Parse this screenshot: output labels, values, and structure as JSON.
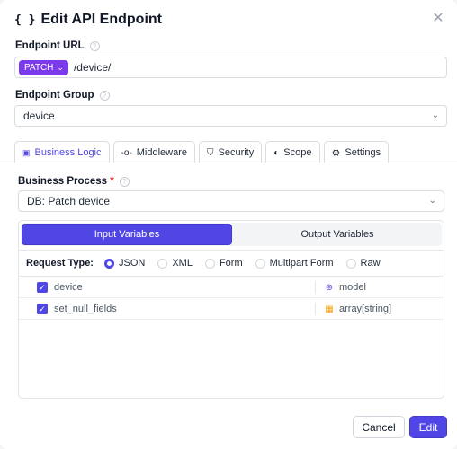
{
  "dialog": {
    "title": "Edit API Endpoint",
    "title_icon": "braces-icon",
    "close_icon": "close-icon"
  },
  "endpoint_url": {
    "label": "Endpoint URL",
    "method": "PATCH",
    "path": "/device/"
  },
  "endpoint_group": {
    "label": "Endpoint Group",
    "value": "device"
  },
  "tabs": [
    {
      "label": "Business Logic",
      "icon": "play-square-icon",
      "active": true
    },
    {
      "label": "Middleware",
      "icon": "commit-icon",
      "active": false
    },
    {
      "label": "Security",
      "icon": "shield-icon",
      "active": false
    },
    {
      "label": "Scope",
      "icon": "contrast-icon",
      "active": false
    },
    {
      "label": "Settings",
      "icon": "gear-icon",
      "active": false
    }
  ],
  "business_process": {
    "label": "Business Process",
    "required_mark": "*",
    "value": "DB: Patch device"
  },
  "variables": {
    "input_tab": "Input Variables",
    "output_tab": "Output Variables",
    "request_type_label": "Request Type:",
    "request_types": [
      "JSON",
      "XML",
      "Form",
      "Multipart Form",
      "Raw"
    ],
    "selected_request_type": "JSON",
    "rows": [
      {
        "name": "device",
        "checked": true,
        "type": "model",
        "type_icon": "model-icon"
      },
      {
        "name": "set_null_fields",
        "checked": true,
        "type": "array[string]",
        "type_icon": "grid-icon"
      }
    ]
  },
  "footer": {
    "cancel_label": "Cancel",
    "edit_label": "Edit"
  },
  "colors": {
    "accent": "#4f46e5",
    "method_badge": "#7c3aed"
  }
}
